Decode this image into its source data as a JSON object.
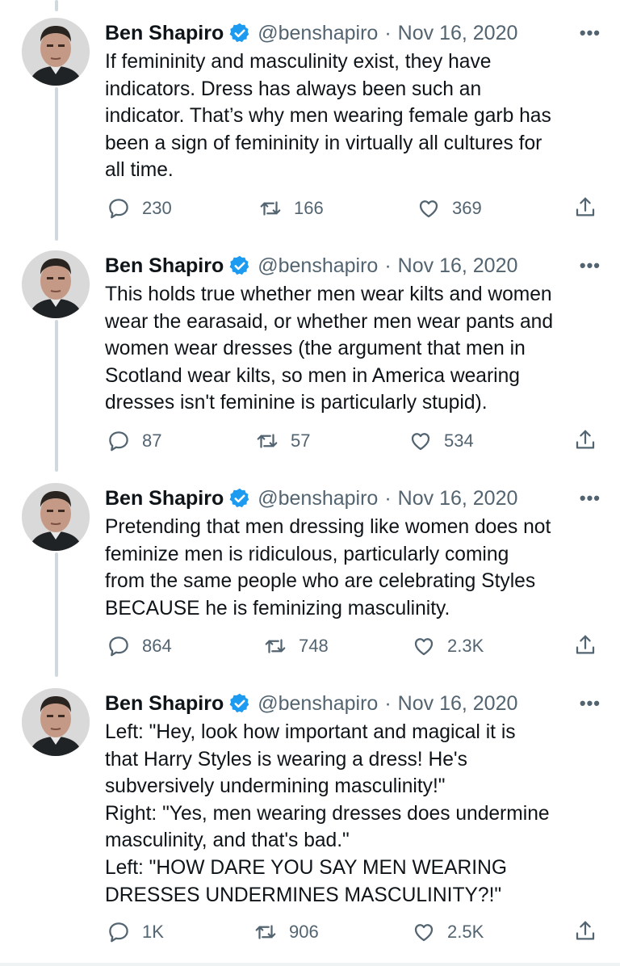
{
  "colors": {
    "verified": "#1d9bf0",
    "secondary_text": "#536471",
    "thread_line": "#cfd9de"
  },
  "tweets": [
    {
      "name": "Ben Shapiro",
      "handle": "@benshapiro",
      "separator": "·",
      "date": "Nov 16, 2020",
      "more": "•••",
      "text": "If femininity and masculinity exist, they have\nindicators. Dress has always been such an\nindicator. That’s why men wearing female garb has\nbeen a sign of femininity in virtually all cultures for\nall time.",
      "replies": "230",
      "retweets": "166",
      "likes": "369"
    },
    {
      "name": "Ben Shapiro",
      "handle": "@benshapiro",
      "separator": "·",
      "date": "Nov 16, 2020",
      "more": "•••",
      "text": "This holds true whether men wear kilts and women\nwear the earasaid, or whether men wear pants and\nwomen wear dresses (the argument that men in\nScotland wear kilts, so men in America wearing\ndresses isn't feminine is particularly stupid).",
      "replies": "87",
      "retweets": "57",
      "likes": "534"
    },
    {
      "name": "Ben Shapiro",
      "handle": "@benshapiro",
      "separator": "·",
      "date": "Nov 16, 2020",
      "more": "•••",
      "text": "Pretending that men dressing like women does not\nfeminize men is ridiculous, particularly coming\nfrom the same people who are celebrating Styles\nBECAUSE he is feminizing masculinity.",
      "replies": "864",
      "retweets": "748",
      "likes": "2.3K"
    },
    {
      "name": "Ben Shapiro",
      "handle": "@benshapiro",
      "separator": "·",
      "date": "Nov 16, 2020",
      "more": "•••",
      "text": "Left: \"Hey, look how important and magical it is\nthat Harry Styles is wearing a dress! He's\nsubversively undermining masculinity!\"\nRight: \"Yes, men wearing dresses does undermine\nmasculinity, and that's bad.\"\nLeft: \"HOW DARE YOU SAY MEN WEARING\nDRESSES UNDERMINES MASCULINITY?!\"",
      "replies": "1K",
      "retweets": "906",
      "likes": "2.5K"
    }
  ]
}
